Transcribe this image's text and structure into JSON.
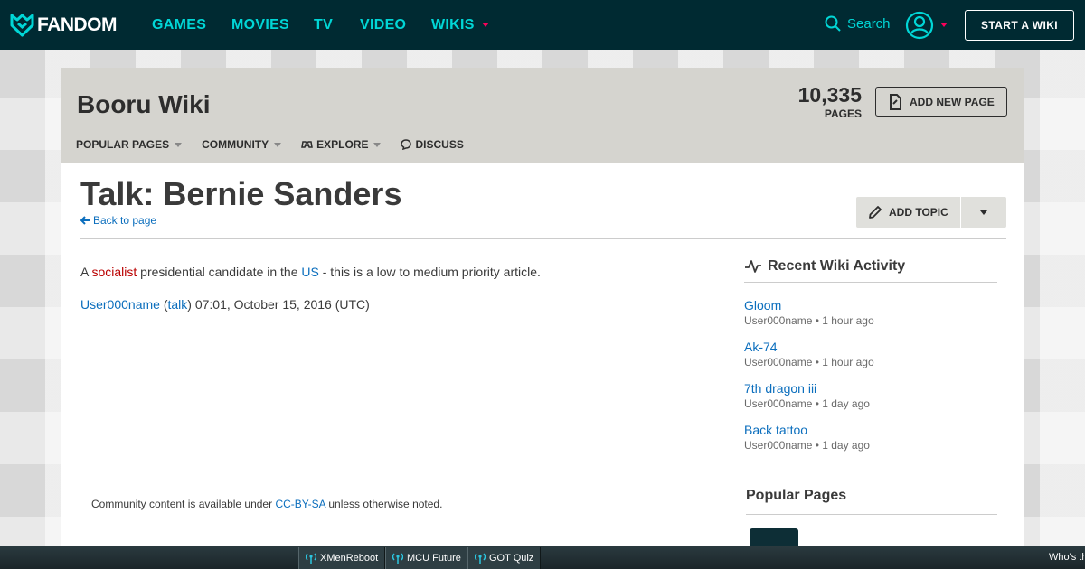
{
  "global_nav": {
    "brand": "FANDOM",
    "links": [
      "GAMES",
      "MOVIES",
      "TV",
      "VIDEO",
      "WIKIS"
    ],
    "search_label": "Search",
    "start_wiki": "START A WIKI"
  },
  "wiki_header": {
    "title": "Booru Wiki",
    "page_count": "10,335",
    "page_count_label": "PAGES",
    "add_new_page": "ADD NEW PAGE",
    "nav": [
      "POPULAR PAGES",
      "COMMUNITY",
      "EXPLORE",
      "DISCUSS"
    ]
  },
  "page": {
    "title": "Talk: Bernie Sanders",
    "back_link": "Back to page",
    "add_topic": "ADD TOPIC",
    "article": {
      "p1_a": "A ",
      "p1_link1": "socialist",
      "p1_b": " presidential candidate in the ",
      "p1_link2": "US",
      "p1_c": " - this is a low to medium priority article.",
      "sig_user": "User000name",
      "sig_open": " (",
      "sig_talk": "talk",
      "sig_close": ") 07:01, October 15, 2016 (UTC)"
    },
    "license_a": "Community content is available under ",
    "license_link": "CC-BY-SA",
    "license_b": " unless otherwise noted."
  },
  "rail": {
    "recent_title": "Recent Wiki Activity",
    "activity": [
      {
        "name": "Gloom",
        "meta": "User000name • 1 hour ago"
      },
      {
        "name": "Ak-74",
        "meta": "User000name • 1 hour ago"
      },
      {
        "name": "7th dragon iii",
        "meta": "User000name • 1 day ago"
      },
      {
        "name": "Back tattoo",
        "meta": "User000name • 1 day ago"
      }
    ],
    "popular_title": "Popular Pages"
  },
  "bottom_bar": {
    "items": [
      "XMenReboot",
      "MCU Future",
      "GOT Quiz"
    ],
    "right_text": "Who's th"
  },
  "colors": {
    "nav_bg": "#002a32",
    "nav_link": "#00d6d6",
    "accent": "#fa005a",
    "link": "#0b6ebd",
    "redlink": "#ba0000",
    "header_bg": "#d5d4cf"
  }
}
